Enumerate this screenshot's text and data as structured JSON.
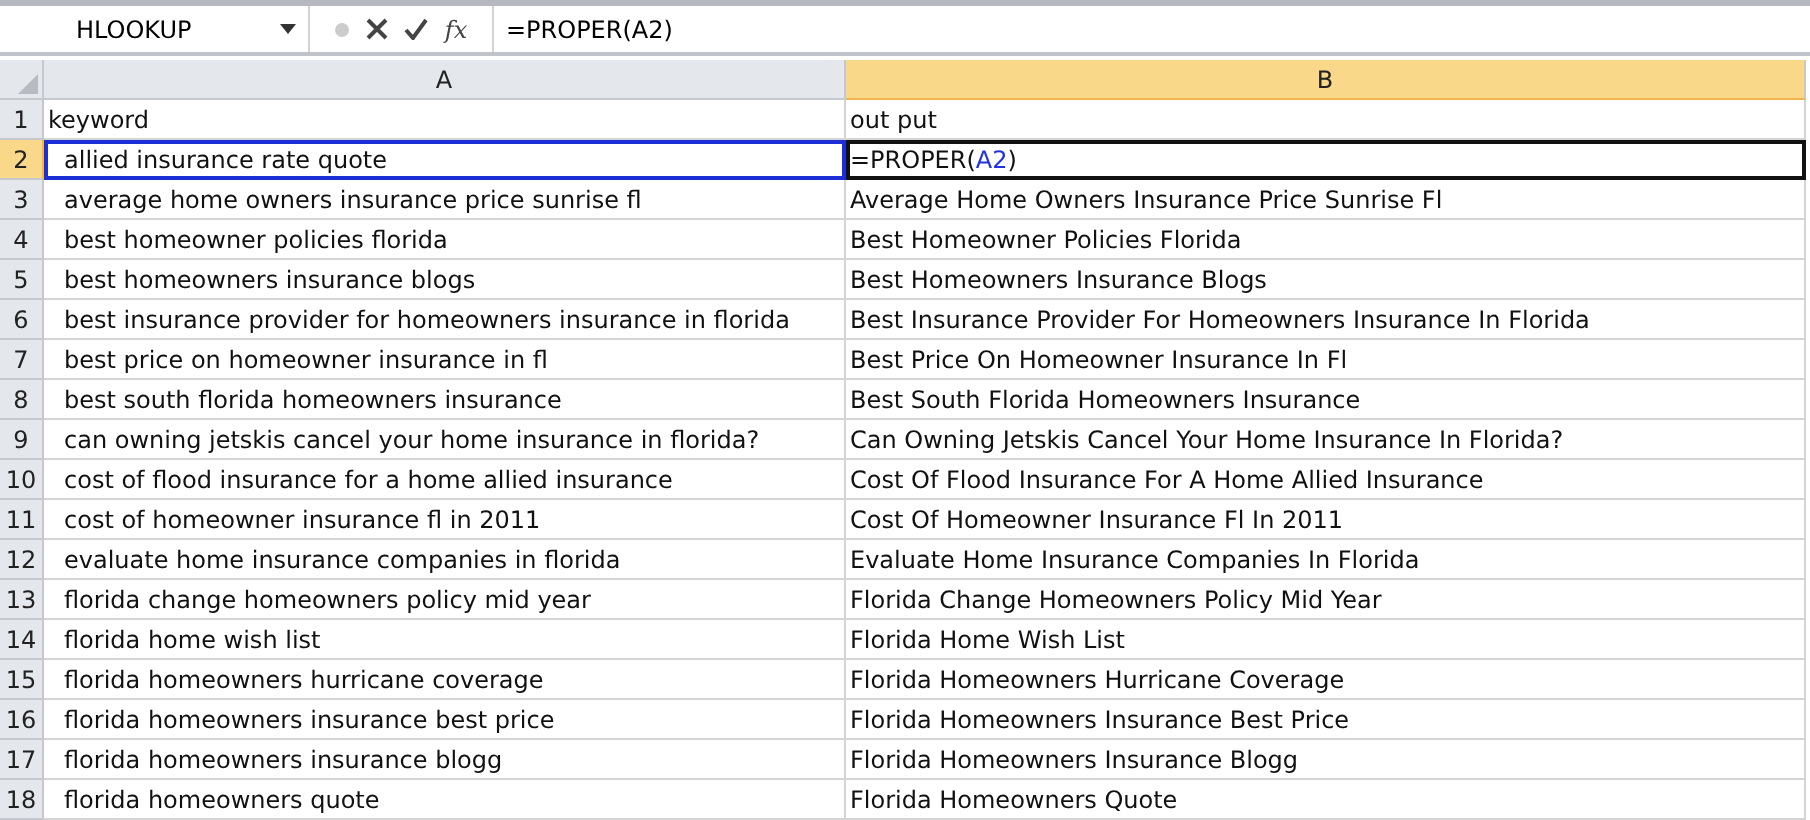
{
  "formula_bar": {
    "name_box": "HLOOKUP",
    "fx": "fx",
    "formula": "=PROPER(A2)"
  },
  "columns": [
    {
      "label": "A",
      "selected": false
    },
    {
      "label": "B",
      "selected": true
    }
  ],
  "rows": [
    {
      "number": "1",
      "selected": false,
      "a": {
        "text": "keyword",
        "indented": false,
        "referenced": false
      },
      "b": {
        "text": "out put",
        "active": false
      }
    },
    {
      "number": "2",
      "selected": true,
      "a": {
        "text": "allied insurance rate quote",
        "indented": true,
        "referenced": true
      },
      "b": {
        "active": true,
        "parts": [
          {
            "text": "=PROPER(",
            "kind": "plain"
          },
          {
            "text": "A2",
            "kind": "reference"
          },
          {
            "text": ")",
            "kind": "plain"
          }
        ]
      }
    },
    {
      "number": "3",
      "selected": false,
      "a": {
        "text": "average home owners insurance price sunrise fl",
        "indented": true,
        "referenced": false
      },
      "b": {
        "text": "Average Home Owners Insurance Price Sunrise Fl",
        "active": false
      }
    },
    {
      "number": "4",
      "selected": false,
      "a": {
        "text": "best homeowner policies florida",
        "indented": true,
        "referenced": false
      },
      "b": {
        "text": "Best Homeowner Policies Florida",
        "active": false
      }
    },
    {
      "number": "5",
      "selected": false,
      "a": {
        "text": "best homeowners insurance blogs",
        "indented": true,
        "referenced": false
      },
      "b": {
        "text": "Best Homeowners Insurance Blogs",
        "active": false
      }
    },
    {
      "number": "6",
      "selected": false,
      "a": {
        "text": "best insurance provider for homeowners insurance in florida",
        "indented": true,
        "referenced": false
      },
      "b": {
        "text": "Best Insurance Provider For Homeowners Insurance In Florida",
        "active": false
      }
    },
    {
      "number": "7",
      "selected": false,
      "a": {
        "text": "best price on homeowner insurance in fl",
        "indented": true,
        "referenced": false
      },
      "b": {
        "text": "Best Price On Homeowner Insurance In Fl",
        "active": false
      }
    },
    {
      "number": "8",
      "selected": false,
      "a": {
        "text": "best south florida homeowners insurance",
        "indented": true,
        "referenced": false
      },
      "b": {
        "text": "Best South Florida Homeowners Insurance",
        "active": false
      }
    },
    {
      "number": "9",
      "selected": false,
      "a": {
        "text": "can owning jetskis cancel your home insurance in florida?",
        "indented": true,
        "referenced": false
      },
      "b": {
        "text": "Can Owning Jetskis Cancel Your Home Insurance In Florida?",
        "active": false
      }
    },
    {
      "number": "10",
      "selected": false,
      "a": {
        "text": "cost of flood insurance for a home allied insurance",
        "indented": true,
        "referenced": false
      },
      "b": {
        "text": "Cost Of Flood Insurance For A Home Allied Insurance",
        "active": false
      }
    },
    {
      "number": "11",
      "selected": false,
      "a": {
        "text": "cost of homeowner insurance fl in 2011",
        "indented": true,
        "referenced": false
      },
      "b": {
        "text": "Cost Of Homeowner Insurance Fl In 2011",
        "active": false
      }
    },
    {
      "number": "12",
      "selected": false,
      "a": {
        "text": "evaluate home insurance companies in florida",
        "indented": true,
        "referenced": false
      },
      "b": {
        "text": "Evaluate Home Insurance Companies In Florida",
        "active": false
      }
    },
    {
      "number": "13",
      "selected": false,
      "a": {
        "text": "florida change homeowners policy mid year",
        "indented": true,
        "referenced": false
      },
      "b": {
        "text": "Florida Change Homeowners Policy Mid Year",
        "active": false
      }
    },
    {
      "number": "14",
      "selected": false,
      "a": {
        "text": "florida home wish list",
        "indented": true,
        "referenced": false
      },
      "b": {
        "text": "Florida Home Wish List",
        "active": false
      }
    },
    {
      "number": "15",
      "selected": false,
      "a": {
        "text": "florida homeowners hurricane coverage",
        "indented": true,
        "referenced": false
      },
      "b": {
        "text": "Florida Homeowners Hurricane Coverage",
        "active": false
      }
    },
    {
      "number": "16",
      "selected": false,
      "a": {
        "text": "florida homeowners insurance best price",
        "indented": true,
        "referenced": false
      },
      "b": {
        "text": "Florida Homeowners Insurance Best Price",
        "active": false
      }
    },
    {
      "number": "17",
      "selected": false,
      "a": {
        "text": "florida homeowners insurance blogg",
        "indented": true,
        "referenced": false
      },
      "b": {
        "text": "Florida Homeowners Insurance Blogg",
        "active": false
      }
    },
    {
      "number": "18",
      "selected": false,
      "a": {
        "text": "florida homeowners quote",
        "indented": true,
        "referenced": false
      },
      "b": {
        "text": "Florida Homeowners Quote",
        "active": false
      }
    }
  ]
}
